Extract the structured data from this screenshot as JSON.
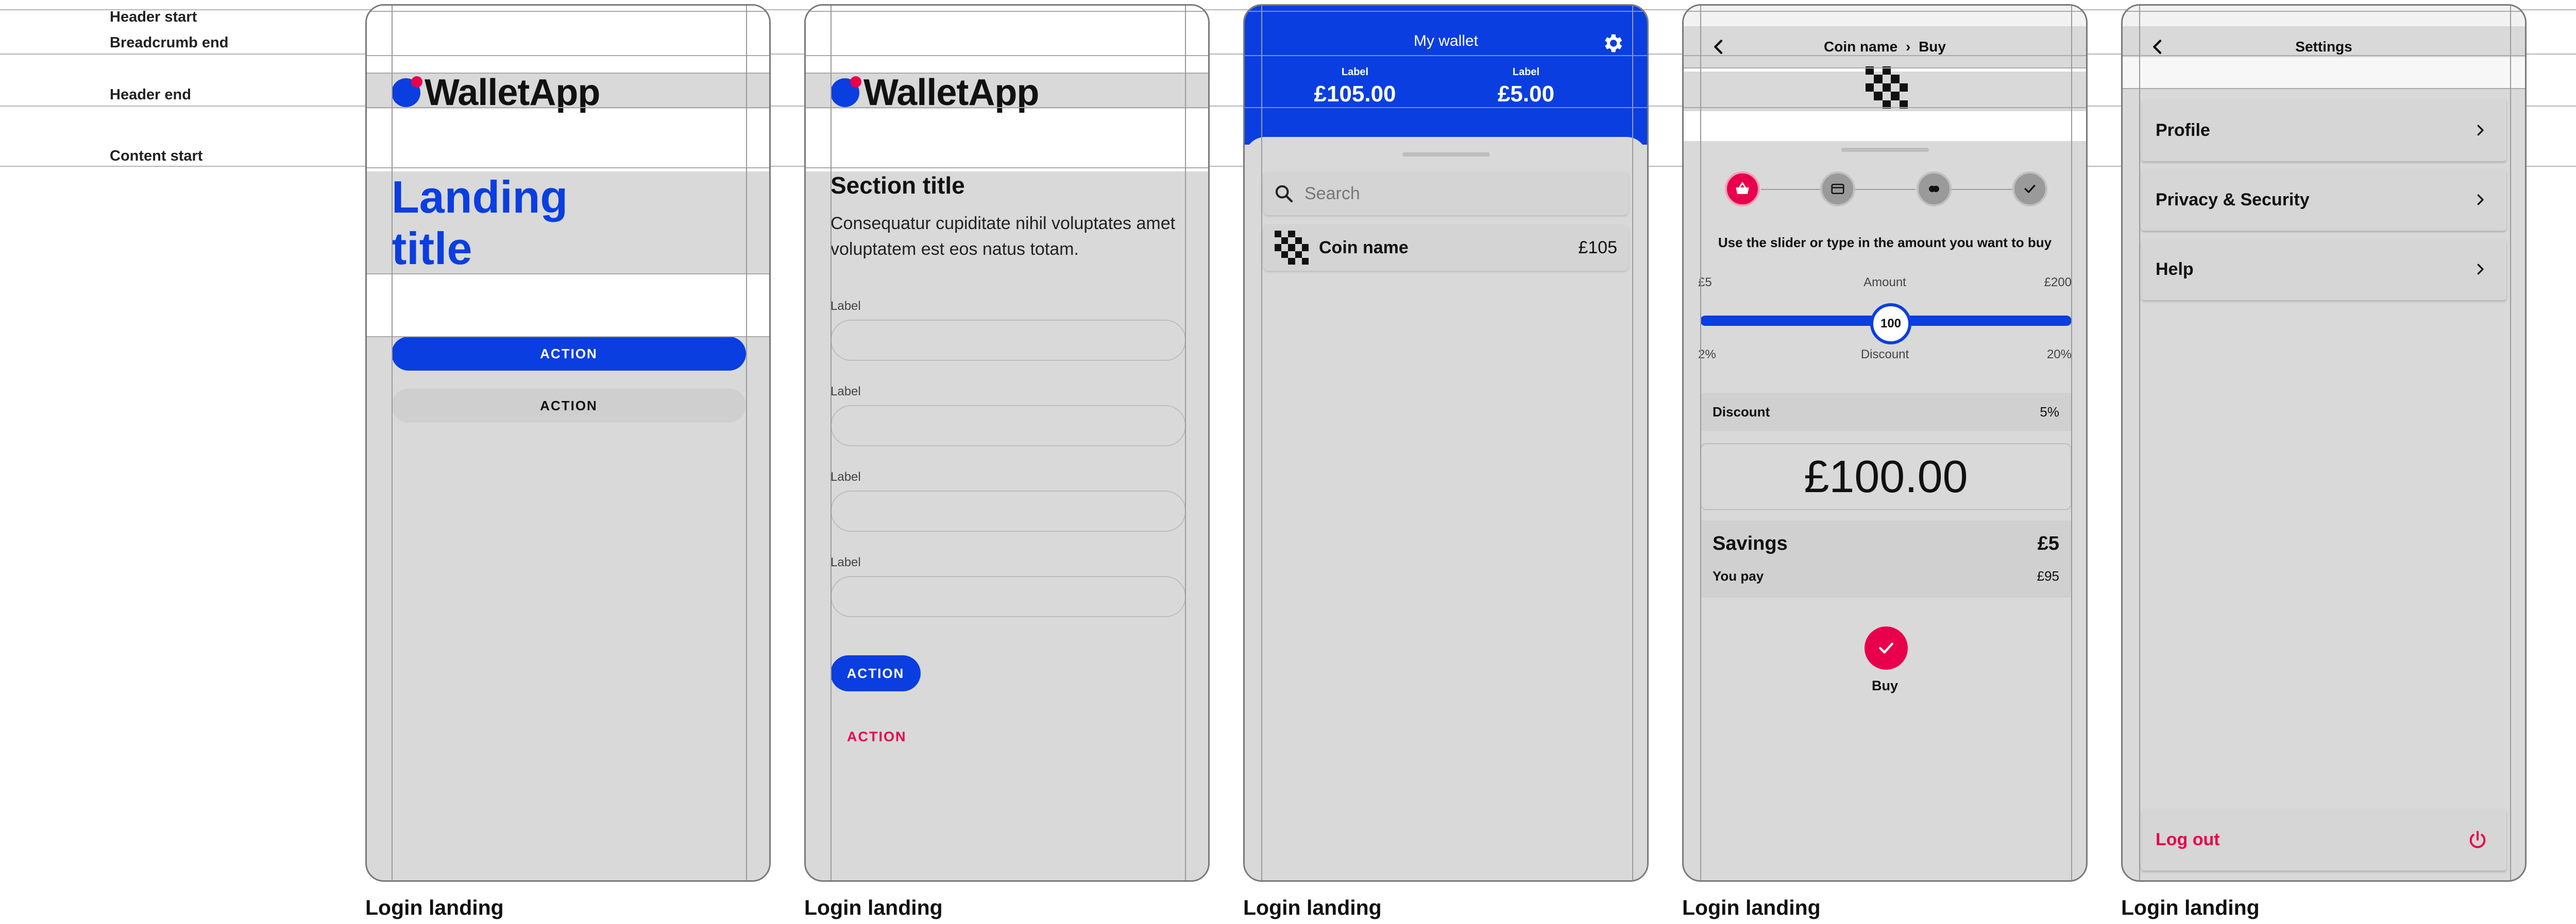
{
  "guides": {
    "header_start": "Header start",
    "breadcrumb_end": "Breadcrumb end",
    "header_end": "Header end",
    "content_start": "Content start"
  },
  "colors": {
    "primary": "#0a3ee0",
    "accent": "#e8004c",
    "artboard": "#d9d9d9"
  },
  "brand": {
    "name": "WalletApp"
  },
  "captions": [
    "Login landing",
    "Login landing",
    "Login landing",
    "Login landing",
    "Login landing"
  ],
  "landing": {
    "title": "Landing title",
    "primary_action": "ACTION",
    "secondary_action": "ACTION"
  },
  "form": {
    "section_title": "Section title",
    "body": "Consequatur cupiditate nihil voluptates amet voluptatem est eos natus totam.",
    "fields": [
      {
        "label": "Label",
        "value": ""
      },
      {
        "label": "Label",
        "value": ""
      },
      {
        "label": "Label",
        "value": ""
      },
      {
        "label": "Label",
        "value": ""
      }
    ],
    "primary_action": "ACTION",
    "secondary_action": "ACTION"
  },
  "wallet": {
    "title": "My wallet",
    "stats": [
      {
        "label": "Label",
        "value": "£105.00"
      },
      {
        "label": "Label",
        "value": "£5.00"
      }
    ],
    "search_placeholder": "Search",
    "coins": [
      {
        "name": "Coin name",
        "value": "£105",
        "icon": "checker-coin-icon"
      }
    ]
  },
  "buy": {
    "breadcrumb": {
      "parent": "Coin name",
      "separator": "›",
      "current": "Buy"
    },
    "steps": [
      {
        "icon": "basket-icon",
        "active": true
      },
      {
        "icon": "card-icon",
        "active": false
      },
      {
        "icon": "coins-icon",
        "active": false
      },
      {
        "icon": "check-icon",
        "active": false
      }
    ],
    "instruction": "Use the slider or type in the amount you want to buy",
    "amount_slider": {
      "min_label": "£5",
      "label": "Amount",
      "max_label": "£200",
      "value": 100,
      "value_label": "100"
    },
    "discount_scale": {
      "min_label": "2%",
      "label": "Discount",
      "max_label": "20%"
    },
    "discount": {
      "label": "Discount",
      "value": "5%"
    },
    "amount": "£100.00",
    "savings": {
      "label": "Savings",
      "value": "£5",
      "pay_label": "You pay",
      "pay_value": "£95"
    },
    "buy_label": "Buy"
  },
  "settings": {
    "title": "Settings",
    "items": [
      {
        "label": "Profile"
      },
      {
        "label": "Privacy & Security"
      },
      {
        "label": "Help"
      }
    ],
    "logout": "Log out"
  }
}
